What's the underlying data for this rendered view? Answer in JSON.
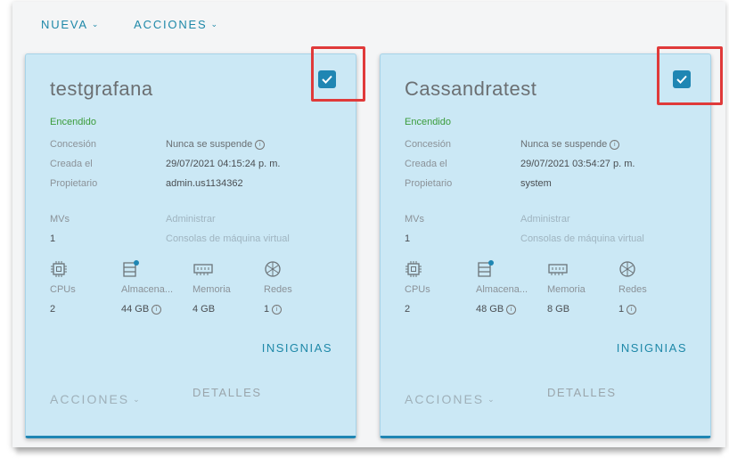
{
  "toolbar": {
    "new_label": "NUEVA",
    "actions_label": "ACCIONES"
  },
  "cards": [
    {
      "name": "testgrafana",
      "checked": true,
      "status": "Encendido",
      "lease_label": "Concesión",
      "lease_value": "Nunca se suspende",
      "created_label": "Creada el",
      "created_value": "29/07/2021 04:15:24 p. m.",
      "owner_label": "Propietario",
      "owner_value": "admin.us1134362",
      "vms_label": "MVs",
      "vms_value": "1",
      "manage_link": "Administrar",
      "console_link": "Consolas de máquina virtual",
      "cpus_label": "CPUs",
      "cpus_value": "2",
      "storage_label": "Almacena...",
      "storage_value": "44 GB",
      "memory_label": "Memoria",
      "memory_value": "4 GB",
      "networks_label": "Redes",
      "networks_value": "1",
      "badges_label": "INSIGNIAS",
      "actions_label": "ACCIONES",
      "details_label": "DETALLES"
    },
    {
      "name": "Cassandratest",
      "checked": true,
      "status": "Encendido",
      "lease_label": "Concesión",
      "lease_value": "Nunca se suspende",
      "created_label": "Creada el",
      "created_value": "29/07/2021 03:54:27 p. m.",
      "owner_label": "Propietario",
      "owner_value": "system",
      "vms_label": "MVs",
      "vms_value": "1",
      "manage_link": "Administrar",
      "console_link": "Consolas de máquina virtual",
      "cpus_label": "CPUs",
      "cpus_value": "2",
      "storage_label": "Almacena...",
      "storage_value": "48 GB",
      "memory_label": "Memoria",
      "memory_value": "8 GB",
      "networks_label": "Redes",
      "networks_value": "1",
      "badges_label": "INSIGNIAS",
      "actions_label": "ACCIONES",
      "details_label": "DETALLES"
    }
  ],
  "colors": {
    "accent": "#1e88a8",
    "card_bg": "#cbe8f5",
    "status_green": "#3b9c3b",
    "highlight_red": "#e03a3a"
  },
  "icons": [
    "chevron-down-icon",
    "checkmark-icon",
    "info-icon",
    "cpu-icon",
    "storage-icon",
    "memory-icon",
    "network-icon"
  ]
}
